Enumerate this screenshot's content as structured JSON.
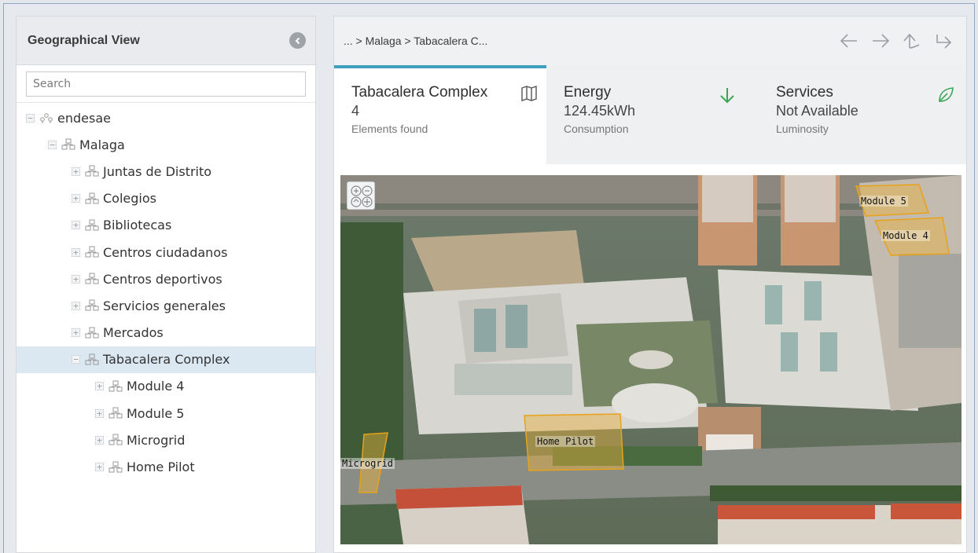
{
  "left_panel": {
    "title": "Geographical View",
    "search_placeholder": "Search",
    "tree": [
      {
        "label": "endesae",
        "level": 0,
        "toggle": "−",
        "icon": "device-network-icon"
      },
      {
        "label": "Malaga",
        "level": 1,
        "toggle": "−",
        "icon": "hierarchy-icon"
      },
      {
        "label": "Juntas de Distrito",
        "level": 2,
        "toggle": "+",
        "icon": "hierarchy-icon"
      },
      {
        "label": "Colegios",
        "level": 2,
        "toggle": "+",
        "icon": "hierarchy-icon"
      },
      {
        "label": "Bibliotecas",
        "level": 2,
        "toggle": "+",
        "icon": "hierarchy-icon"
      },
      {
        "label": "Centros ciudadanos",
        "level": 2,
        "toggle": "+",
        "icon": "hierarchy-icon"
      },
      {
        "label": "Centros deportivos",
        "level": 2,
        "toggle": "+",
        "icon": "hierarchy-icon"
      },
      {
        "label": "Servicios generales",
        "level": 2,
        "toggle": "+",
        "icon": "hierarchy-icon"
      },
      {
        "label": "Mercados",
        "level": 2,
        "toggle": "+",
        "icon": "hierarchy-icon"
      },
      {
        "label": "Tabacalera Complex",
        "level": 2,
        "toggle": "−",
        "icon": "hierarchy-icon",
        "selected": true
      },
      {
        "label": "Module 4",
        "level": 3,
        "toggle": "+",
        "icon": "hierarchy-icon"
      },
      {
        "label": "Module 5",
        "level": 3,
        "toggle": "+",
        "icon": "hierarchy-icon"
      },
      {
        "label": "Microgrid",
        "level": 3,
        "toggle": "+",
        "icon": "hierarchy-icon"
      },
      {
        "label": "Home Pilot",
        "level": 3,
        "toggle": "+",
        "icon": "hierarchy-icon"
      }
    ]
  },
  "right_panel": {
    "breadcrumb": "... > Malaga > Tabacalera C...",
    "nav_icons": [
      "arrow-left-icon",
      "arrow-right-icon",
      "arrow-up-icon",
      "arrow-jump-icon"
    ],
    "cards": [
      {
        "title": "Tabacalera Complex",
        "value": "4",
        "sub": "Elements found",
        "icon": "map-icon"
      },
      {
        "title": "Energy",
        "value": "124.45kWh",
        "sub": "Consumption",
        "icon": "arrow-down-icon"
      },
      {
        "title": "Services",
        "value": "Not Available",
        "sub": "Luminosity",
        "icon": "leaf-icon"
      }
    ],
    "map_labels": {
      "module5": "Module 5",
      "module4": "Module 4",
      "home_pilot": "Home Pilot",
      "microgrid": "Microgrid"
    }
  },
  "colors": {
    "accent": "#3f9fbf",
    "green_icon": "#3aa655",
    "highlight": "#e8b23a",
    "selected_row": "#dbe7f1"
  }
}
